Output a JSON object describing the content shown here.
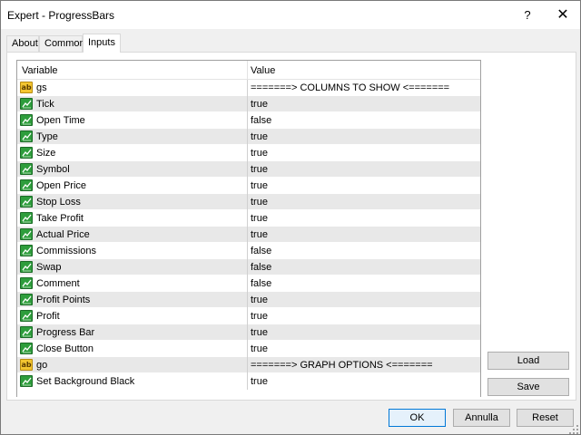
{
  "window": {
    "title": "Expert - ProgressBars",
    "help_label": "?",
    "close_label": "✕"
  },
  "tabs": [
    {
      "label": "About"
    },
    {
      "label": "Common"
    },
    {
      "label": "Inputs",
      "active": true
    }
  ],
  "grid": {
    "columns": {
      "variable": "Variable",
      "value": "Value"
    },
    "rows": [
      {
        "icon": "string-icon",
        "icon_text": "ab",
        "name": "gs",
        "value": "=======> COLUMNS TO SHOW <======="
      },
      {
        "icon": "param-icon",
        "name": "Tick",
        "value": "true"
      },
      {
        "icon": "param-icon",
        "name": "Open Time",
        "value": "false"
      },
      {
        "icon": "param-icon",
        "name": "Type",
        "value": "true"
      },
      {
        "icon": "param-icon",
        "name": "Size",
        "value": "true"
      },
      {
        "icon": "param-icon",
        "name": "Symbol",
        "value": "true"
      },
      {
        "icon": "param-icon",
        "name": "Open Price",
        "value": "true"
      },
      {
        "icon": "param-icon",
        "name": "Stop Loss",
        "value": "true"
      },
      {
        "icon": "param-icon",
        "name": "Take Profit",
        "value": "true"
      },
      {
        "icon": "param-icon",
        "name": "Actual Price",
        "value": "true"
      },
      {
        "icon": "param-icon",
        "name": "Commissions",
        "value": "false"
      },
      {
        "icon": "param-icon",
        "name": "Swap",
        "value": "false"
      },
      {
        "icon": "param-icon",
        "name": "Comment",
        "value": "false"
      },
      {
        "icon": "param-icon",
        "name": "Profit Points",
        "value": "true"
      },
      {
        "icon": "param-icon",
        "name": "Profit",
        "value": "true"
      },
      {
        "icon": "param-icon",
        "name": "Progress Bar",
        "value": "true"
      },
      {
        "icon": "param-icon",
        "name": "Close Button",
        "value": "true"
      },
      {
        "icon": "string-icon",
        "icon_text": "ab",
        "name": "go",
        "value": "=======> GRAPH OPTIONS <======="
      },
      {
        "icon": "param-icon",
        "name": "Set Background Black",
        "value": "true"
      }
    ]
  },
  "buttons": {
    "load": "Load",
    "save": "Save",
    "ok": "OK",
    "cancel": "Annulla",
    "reset": "Reset"
  },
  "colors": {
    "row_alt": "#e8e8e8",
    "param_icon": "#2e9d3c",
    "string_icon": "#f3c530",
    "ok_border": "#0078d7"
  }
}
